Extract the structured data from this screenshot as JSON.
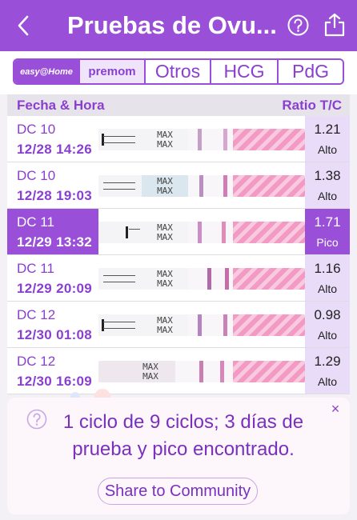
{
  "header": {
    "title": "Pruebas de Ovu...",
    "back_icon": "chevron-left-icon",
    "help_icon": "question-circle-icon",
    "share_icon": "share-icon"
  },
  "tabs": [
    {
      "label": "easy@Home",
      "active": true
    },
    {
      "label": "premom",
      "active": false
    },
    {
      "label": "Otros",
      "active": false
    },
    {
      "label": "HCG",
      "active": false
    },
    {
      "label": "PdG",
      "active": false
    }
  ],
  "table": {
    "col_left": "Fecha & Hora",
    "col_right": "Ratio T/C",
    "rows": [
      {
        "dc": "DC 10",
        "datetime": "12/28  14:26",
        "strip_text": "MAX\nMAX",
        "ratio": "1.21",
        "level": "Alto",
        "selected": false
      },
      {
        "dc": "DC 10",
        "datetime": "12/28  19:03",
        "strip_text": "MAX\nMAX",
        "ratio": "1.38",
        "level": "Alto",
        "selected": false
      },
      {
        "dc": "DC 11",
        "datetime": "12/29  13:32",
        "strip_text": "MAX\nMAX",
        "ratio": "1.71",
        "level": "Pico",
        "selected": true
      },
      {
        "dc": "DC 11",
        "datetime": "12/29  20:09",
        "strip_text": "MAX\nMAX",
        "ratio": "1.16",
        "level": "Alto",
        "selected": false
      },
      {
        "dc": "DC 12",
        "datetime": "12/30  01:08",
        "strip_text": "MAX\nMAX",
        "ratio": "0.98",
        "level": "Alto",
        "selected": false
      },
      {
        "dc": "DC 12",
        "datetime": "12/30  16:09",
        "strip_text": "MAX\nMAX",
        "ratio": "1.29",
        "level": "Alto",
        "selected": false
      }
    ]
  },
  "card": {
    "message": "1 ciclo de 9 ciclos; 3 días de prueba y pico encontrado.",
    "button": "Share to Community",
    "close": "×"
  },
  "colors": {
    "accent": "#9a4fd8",
    "accent_text": "#8a3fd0",
    "ratio_bg": "#e9dcf8"
  }
}
